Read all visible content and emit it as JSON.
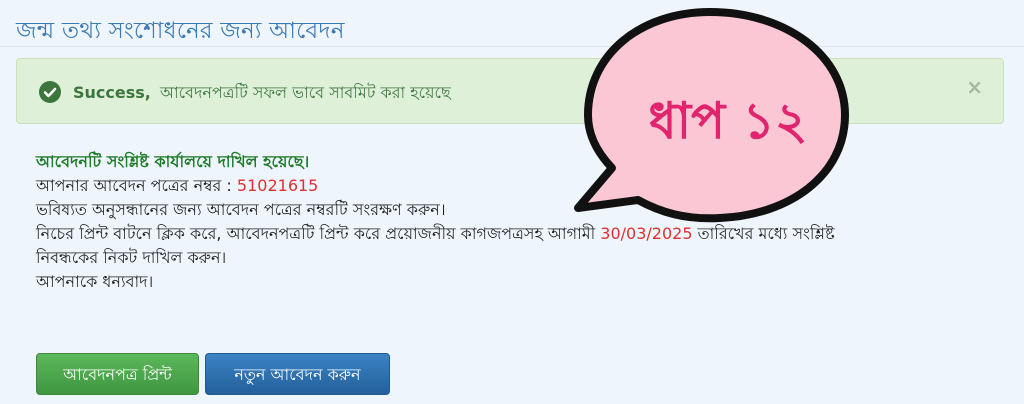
{
  "page": {
    "title": "জন্ম তথ্য সংশোধনের জন্য আবেদন"
  },
  "alert": {
    "strong": "Success,",
    "message": "আবেদনপত্রটি সফল ভাবে সাবমিট করা হয়েছে",
    "close": "×",
    "icon": "check-circle-icon",
    "color": "#3c763d",
    "background": "#dff0d8"
  },
  "content": {
    "filed_notice": "আবেদনটি সংশ্লিষ্ট কার্যালয়ে দাখিল হয়েছে।",
    "app_number_label": "আপনার আবেদন পত্রের নম্বর :",
    "app_number": "51021615",
    "save_notice": "ভবিষ্যত অনুসন্ধানের জন্য আবেদন পত্রের নম্বরটি সংরক্ষণ করুন।",
    "instruction_before": "নিচের প্রিন্ট বাটনে ক্লিক করে, আবেদনপত্রটি প্রিন্ট করে প্রয়োজনীয় কাগজপত্রসহ আগামী",
    "deadline": "30/03/2025",
    "instruction_after": "তারিখের মধ্যে সংশ্লিষ্ট",
    "instruction_line2": "নিবন্ধকের নিকট দাখিল করুন।",
    "thanks": "আপনাকে ধন্যবাদ।"
  },
  "buttons": {
    "print_label": "আবেদনপত্র প্রিন্ট",
    "new_label": "নতুন আবেদন করুন",
    "print_color": "#4cae4c",
    "new_color": "#2a6fb0"
  },
  "overlay": {
    "text": "ধাপ ১২",
    "fill": "#fbc7d4",
    "text_color": "#e0256e"
  }
}
